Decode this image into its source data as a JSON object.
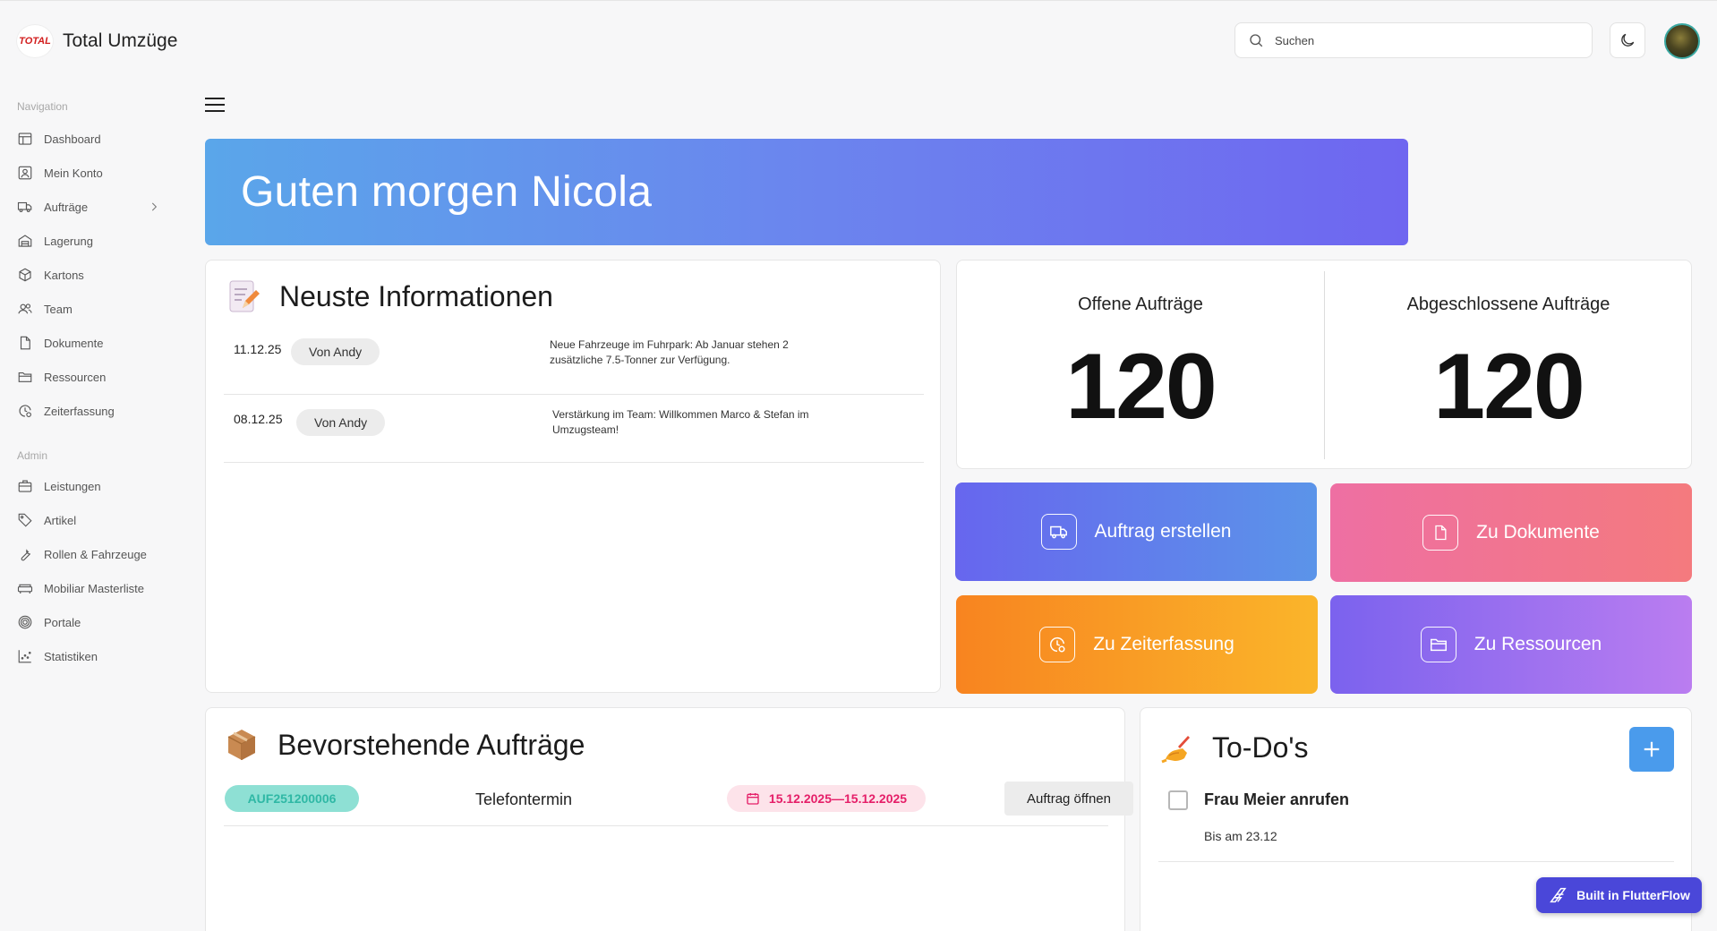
{
  "app": {
    "name": "Total Umzüge",
    "logo_text": "TOTAL"
  },
  "search": {
    "placeholder": "Suchen"
  },
  "sidebar": {
    "navigation_label": "Navigation",
    "items": [
      {
        "label": "Dashboard",
        "icon": "dashboard-icon"
      },
      {
        "label": "Mein Konto",
        "icon": "account-icon"
      },
      {
        "label": "Aufträge",
        "icon": "truck-icon"
      },
      {
        "label": "Lagerung",
        "icon": "warehouse-icon"
      },
      {
        "label": "Kartons",
        "icon": "box-icon"
      },
      {
        "label": "Team",
        "icon": "team-icon"
      },
      {
        "label": "Dokumente",
        "icon": "document-icon"
      },
      {
        "label": "Ressourcen",
        "icon": "folder-icon"
      },
      {
        "label": "Zeiterfassung",
        "icon": "clock-icon"
      }
    ],
    "admin_label": "Admin",
    "admin_items": [
      {
        "label": "Leistungen",
        "icon": "briefcase-icon"
      },
      {
        "label": "Artikel",
        "icon": "tag-icon"
      },
      {
        "label": "Rollen & Fahrzeuge",
        "icon": "wrench-icon"
      },
      {
        "label": "Mobiliar Masterliste",
        "icon": "sofa-icon"
      },
      {
        "label": "Portale",
        "icon": "target-icon"
      },
      {
        "label": "Statistiken",
        "icon": "chart-icon"
      }
    ]
  },
  "greeting": "Guten morgen Nicola",
  "info": {
    "title": "Neuste Informationen",
    "rows": [
      {
        "date": "11.12.25",
        "author": "Von Andy",
        "text": "Neue Fahrzeuge im Fuhrpark: Ab Januar stehen 2 zusätzliche 7.5-Tonner zur Verfügung."
      },
      {
        "date": "08.12.25",
        "author": "Von Andy",
        "text": "Verstärkung im Team: Willkommen Marco & Stefan im Umzugsteam!"
      }
    ]
  },
  "stats": {
    "open_label": "Offene Aufträge",
    "open_value": "120",
    "closed_label": "Abgeschlossene Aufträge",
    "closed_value": "120"
  },
  "actions": {
    "create": "Auftrag erstellen",
    "documents": "Zu Dokumente",
    "time": "Zu Zeiterfassung",
    "resources": "Zu Ressourcen"
  },
  "orders": {
    "title": "Bevorstehende Aufträge",
    "rows": [
      {
        "id": "AUF251200006",
        "type": "Telefontermin",
        "date_range": "15.12.2025—15.12.2025",
        "button": "Auftrag öffnen"
      }
    ]
  },
  "todos": {
    "title": "To-Do's",
    "items": [
      {
        "title": "Frau Meier anrufen",
        "due": "Bis am 23.12"
      }
    ]
  },
  "badge": "Built in FlutterFlow",
  "colors": {
    "accent": "#6b85ee",
    "order_id_bg": "#8ee0d4",
    "date_pill_bg": "#fde3ea",
    "add_button": "#4a9bec",
    "badge_bg": "#4a47d9"
  }
}
